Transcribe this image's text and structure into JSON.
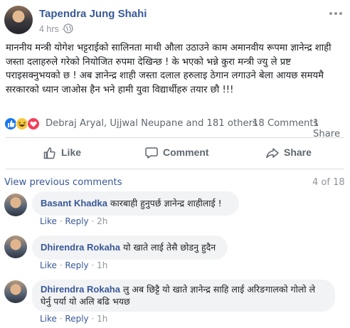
{
  "post": {
    "author": "Tapendra Jung Shahi",
    "time": "4 hrs ·",
    "text": "माननीय मन्त्री योगेश भट्टराईको सालिनता माथी औला उठाउने काम अमानवीय रूपमा ज्ञानेन्द्र शाही जस्ता दलाहरुले गरेको नियोजित रुपमा देखिन्छ ! के भएको भन्ने कुरा मन्त्री ज्यु ले प्रष्ट पराइसक्नुभयको छ ! अब ज्ञानेन्द्र शाही जस्ता दलाल हरुलाइ ठेगान लगाउने बेला आयछ समयमै सरकारको ध्यान जाओस हैन भने हामी युवा विद्यार्थीहरु तयार छौ !!!"
  },
  "reactions": {
    "names": "Debraj Aryal, Ujjwal Neupane and 181 others",
    "comments": "18 Comments",
    "shares": "1 Share",
    "icons": [
      "like-icon",
      "haha-icon",
      "love-icon"
    ]
  },
  "actions": {
    "like": "Like",
    "comment": "Comment",
    "share": "Share"
  },
  "comments_section": {
    "view_previous": "View previous comments",
    "count": "4 of 18",
    "items": [
      {
        "author": "Basant Khadka",
        "text": "कारबाही हुनुपर्छ ज्ञानेन्द्र शाहीलाई !",
        "like": "Like",
        "reply": "Reply",
        "time": "2h"
      },
      {
        "author": "Dhirendra Rokaha",
        "text": "यो खाते लाई तेसै छोडनु हुदैन",
        "like": "Like",
        "reply": "Reply",
        "time": "1h"
      },
      {
        "author": "Dhirendra Rokaha",
        "text": "लु अब छिट्टै यो खाते ज्ञानेन्द्र साहि लाई अरिङगालको गोलो ले घेर्नु पर्या यो अलि बढि भयछ",
        "like": "Like",
        "reply": "Reply",
        "time": "1h"
      }
    ]
  },
  "colors": {
    "link": "#385898",
    "meta": "#90949c",
    "bubble": "#f2f3f5",
    "like_blue": "#1877f2"
  }
}
